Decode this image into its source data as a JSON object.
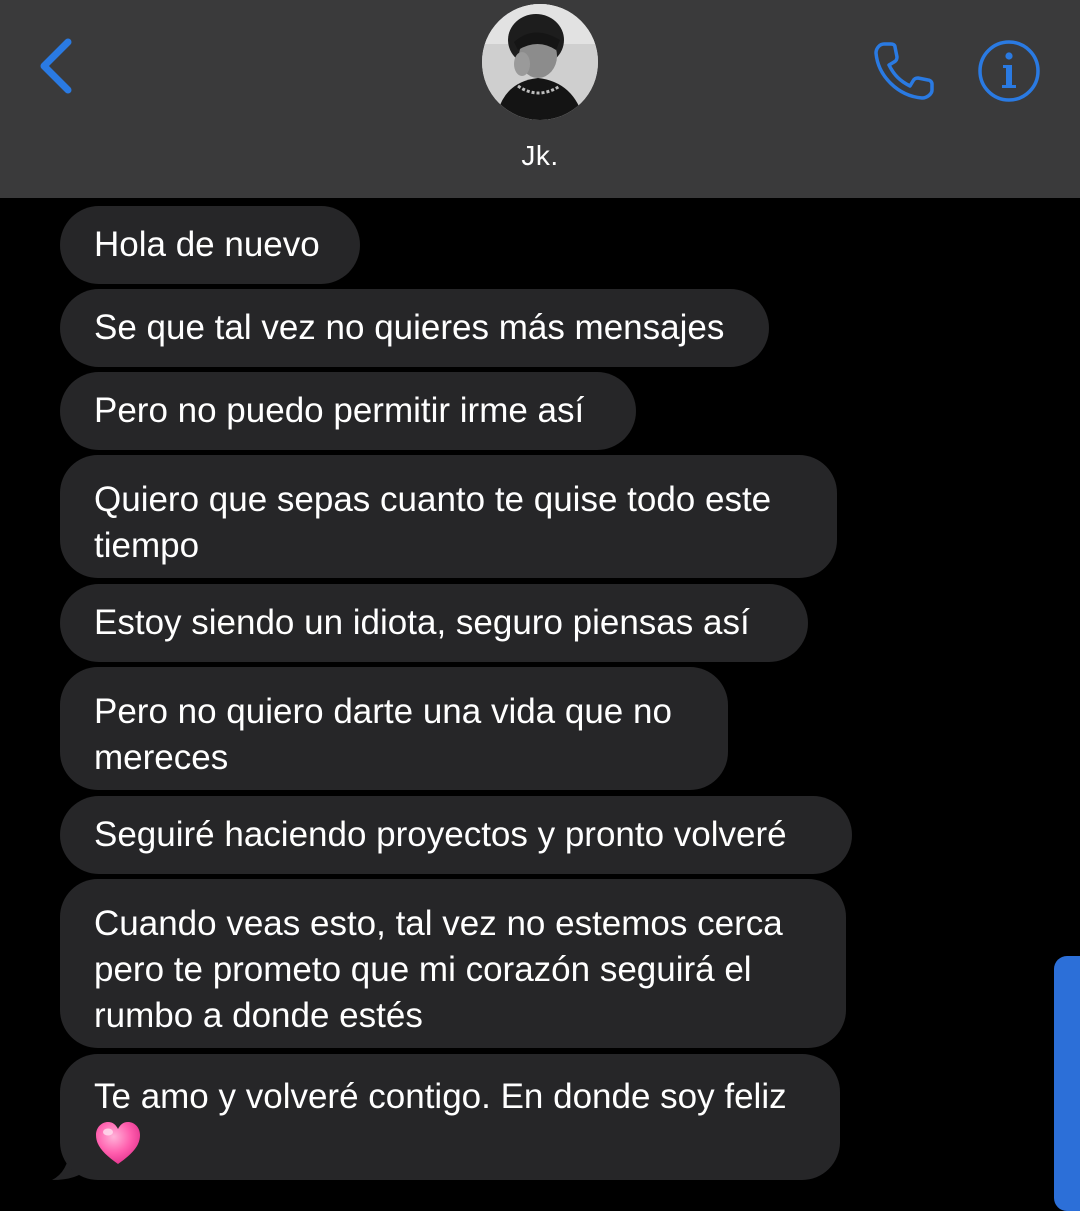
{
  "header": {
    "contact_name": "Jk.",
    "back_icon": "chevron-left-icon",
    "call_icon": "phone-icon",
    "info_icon": "info-icon",
    "accent_color": "#2a7ae2",
    "background_color": "#3a3a3b"
  },
  "messages": [
    {
      "lines": [
        "Hola de nuevo"
      ]
    },
    {
      "lines": [
        "Se que tal vez no quieres más mensajes"
      ]
    },
    {
      "lines": [
        "Pero no puedo permitir irme así"
      ]
    },
    {
      "lines": [
        "Quiero que sepas cuanto te quise todo este",
        "tiempo"
      ]
    },
    {
      "lines": [
        "Estoy siendo un idiota, seguro piensas así"
      ]
    },
    {
      "lines": [
        "Pero no quiero darte una vida que no",
        "mereces"
      ]
    },
    {
      "lines": [
        "Seguiré haciendo proyectos y pronto volveré"
      ]
    },
    {
      "lines": [
        "Cuando veas esto, tal vez no estemos cerca",
        "pero te prometo que mi corazón seguirá el",
        "rumbo a donde estés"
      ]
    },
    {
      "lines": [
        "Te amo y volveré contigo. En donde soy feliz"
      ],
      "emoji": "pink-heart-icon"
    }
  ],
  "bubble_color": "#262628",
  "scrollbar_color": "#2c6fd8"
}
